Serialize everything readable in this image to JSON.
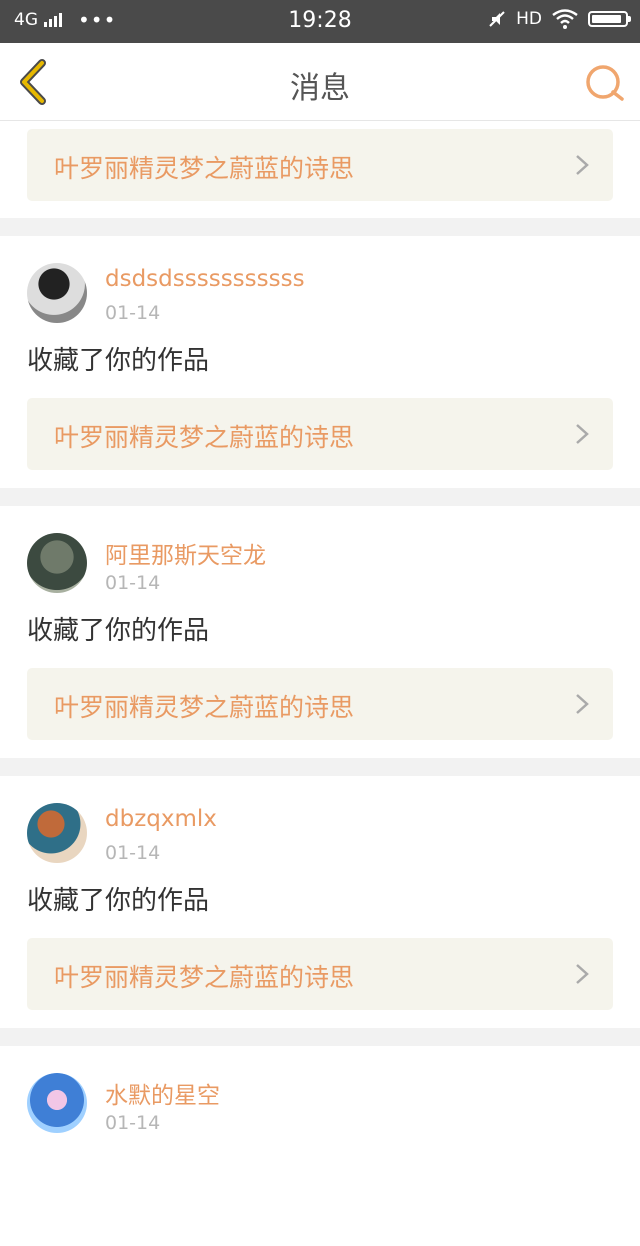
{
  "status_bar": {
    "network": "4G",
    "dots": "•••",
    "time": "19:28",
    "hd": "HD",
    "battery_level": 0.92
  },
  "header": {
    "title": "消息",
    "back_icon": "chevron-left-icon",
    "search_icon": "search-icon"
  },
  "colors": {
    "accent": "#e99a63",
    "back_icon": "#e6b800",
    "work_box_bg": "#f5f4ec"
  },
  "messages": [
    {
      "work_title": "叶罗丽精灵梦之蔚蓝的诗思"
    },
    {
      "username": "dsdsdsssssssssss",
      "date": "01-14",
      "action": "收藏了你的作品",
      "work_title": "叶罗丽精灵梦之蔚蓝的诗思"
    },
    {
      "username": "阿里那斯天空龙",
      "date": "01-14",
      "action": "收藏了你的作品",
      "work_title": "叶罗丽精灵梦之蔚蓝的诗思"
    },
    {
      "username": "dbzqxmlx",
      "date": "01-14",
      "action": "收藏了你的作品",
      "work_title": "叶罗丽精灵梦之蔚蓝的诗思"
    },
    {
      "username": "水默的星空",
      "date": "01-14"
    }
  ]
}
